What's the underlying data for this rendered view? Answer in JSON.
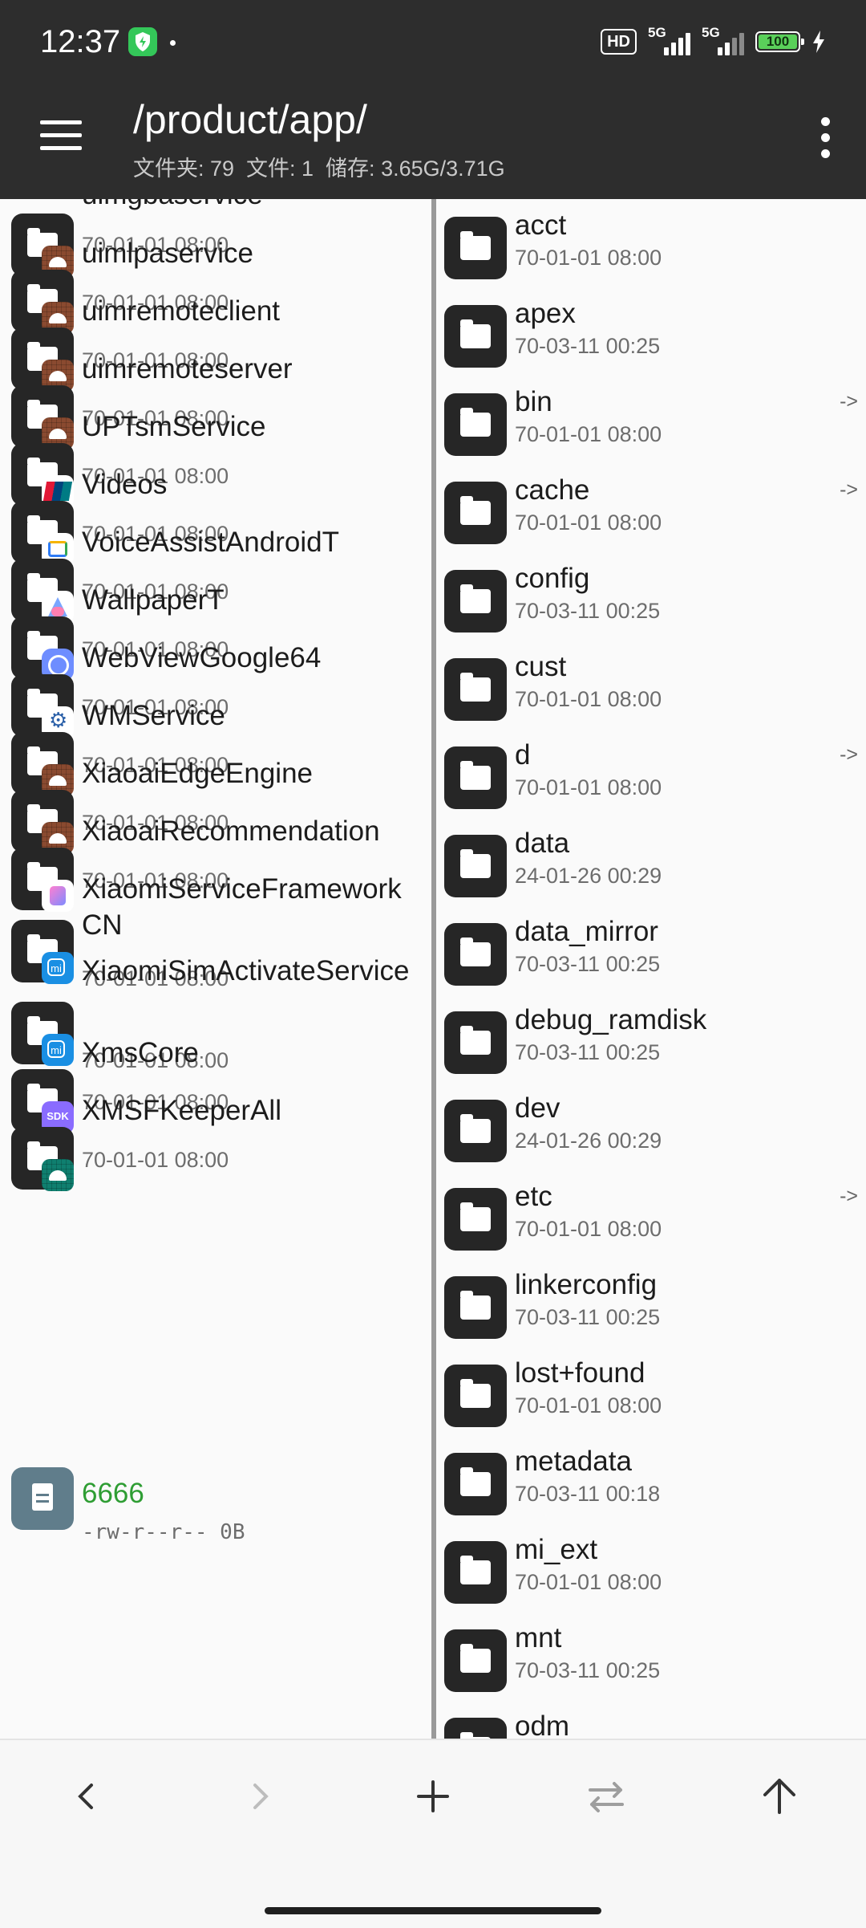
{
  "status_bar": {
    "time": "12:37",
    "hd_label": "HD",
    "net1": "5G",
    "net2": "5G",
    "battery": "100"
  },
  "header": {
    "path": "/product/app/",
    "stats": "文件夹: 79  文件: 1  储存: 3.65G/3.71G"
  },
  "left_pane": {
    "items": [
      {
        "name": "uimgbaservice",
        "date": "70-01-01 08:00",
        "badge": "android"
      },
      {
        "name": "uimlpaservice",
        "date": "70-01-01 08:00",
        "badge": "android"
      },
      {
        "name": "uimremoteclient",
        "date": "70-01-01 08:00",
        "badge": "android"
      },
      {
        "name": "uimremoteserver",
        "date": "70-01-01 08:00",
        "badge": "android"
      },
      {
        "name": "UPTsmService",
        "date": "70-01-01 08:00",
        "badge": "unionpay"
      },
      {
        "name": "Videos",
        "date": "70-01-01 08:00",
        "badge": "videos"
      },
      {
        "name": "VoiceAssistAndroidT",
        "date": "70-01-01 08:00",
        "badge": "voice"
      },
      {
        "name": "WallpaperT",
        "date": "70-01-01 08:00",
        "badge": "wallpaper"
      },
      {
        "name": "WebViewGoogle64",
        "date": "70-01-01 08:00",
        "badge": "webview"
      },
      {
        "name": "WMService",
        "date": "70-01-01 08:00",
        "badge": "android"
      },
      {
        "name": "XiaoaiEdgeEngine",
        "date": "70-01-01 08:00",
        "badge": "android"
      },
      {
        "name": "XiaoaiRecommendation",
        "date": "70-01-01 08:00",
        "badge": "xiaoai"
      },
      {
        "name": "XiaomiServiceFrameworkCN",
        "date": "70-01-01 08:00",
        "badge": "mi"
      },
      {
        "name": "XiaomiSimActivateService",
        "date": "70-01-01 08:00",
        "badge": "mi"
      },
      {
        "name": "XmsCore",
        "date": "70-01-01 08:00",
        "badge": "sdk"
      },
      {
        "name": "XMSFKeeperAll",
        "date": "70-01-01 08:00",
        "badge": "android-teal"
      }
    ],
    "file": {
      "name": "6666",
      "meta": "-rw-r--r-- 0B"
    }
  },
  "right_pane": {
    "items": [
      {
        "name": "acct",
        "date": "70-01-01 08:00",
        "link": ""
      },
      {
        "name": "apex",
        "date": "70-03-11 00:25",
        "link": ""
      },
      {
        "name": "bin",
        "date": "70-01-01 08:00",
        "link": "->"
      },
      {
        "name": "cache",
        "date": "70-01-01 08:00",
        "link": "->"
      },
      {
        "name": "config",
        "date": "70-03-11 00:25",
        "link": ""
      },
      {
        "name": "cust",
        "date": "70-01-01 08:00",
        "link": ""
      },
      {
        "name": "d",
        "date": "70-01-01 08:00",
        "link": "->"
      },
      {
        "name": "data",
        "date": "24-01-26 00:29",
        "link": ""
      },
      {
        "name": "data_mirror",
        "date": "70-03-11 00:25",
        "link": ""
      },
      {
        "name": "debug_ramdisk",
        "date": "70-03-11 00:25",
        "link": ""
      },
      {
        "name": "dev",
        "date": "24-01-26 00:29",
        "link": ""
      },
      {
        "name": "etc",
        "date": "70-01-01 08:00",
        "link": "->"
      },
      {
        "name": "linkerconfig",
        "date": "70-03-11 00:25",
        "link": ""
      },
      {
        "name": "lost+found",
        "date": "70-01-01 08:00",
        "link": ""
      },
      {
        "name": "metadata",
        "date": "70-03-11 00:18",
        "link": ""
      },
      {
        "name": "mi_ext",
        "date": "70-01-01 08:00",
        "link": ""
      },
      {
        "name": "mnt",
        "date": "70-03-11 00:25",
        "link": ""
      },
      {
        "name": "odm",
        "date": "",
        "link": ""
      }
    ]
  },
  "bottom_bar": {
    "buttons": [
      "back-icon",
      "forward-icon",
      "add-icon",
      "swap-icon",
      "up-icon"
    ]
  }
}
